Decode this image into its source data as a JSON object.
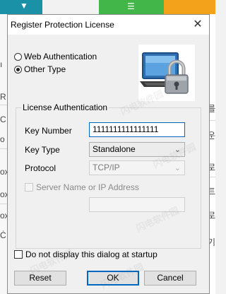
{
  "dialog": {
    "title": "Register Protection License",
    "close_glyph": "✕"
  },
  "auth_mode": {
    "options": [
      {
        "label": "Web Authentication",
        "checked": false
      },
      {
        "label": "Other Type",
        "checked": true
      }
    ]
  },
  "license_group": {
    "title": "License Authentication",
    "key_number_label": "Key Number",
    "key_number_value": "1111111111111111",
    "key_type_label": "Key Type",
    "key_type_value": "Standalone",
    "protocol_label": "Protocol",
    "protocol_value": "TCP/IP",
    "server_checkbox_label": "Server Name or IP Address",
    "server_value": ""
  },
  "startup_checkbox_label": "Do not display this dialog at startup",
  "buttons": {
    "reset": "Reset",
    "ok": "OK",
    "cancel": "Cancel"
  },
  "watermark": "闪电软件园",
  "background": {
    "left_fragments": [
      "ı",
      "R",
      "C",
      "o",
      "ox",
      "ox",
      "ox",
      "Ċ"
    ],
    "right_fragments": [
      "를",
      "운",
      "로",
      "트",
      "로",
      "기"
    ]
  },
  "colors": {
    "accent": "#0067c0",
    "tile_teal": "#1b91a8",
    "tile_green": "#42b649",
    "tile_orange": "#f2a21b"
  },
  "icons": {
    "logo": "laptop-padlock-icon"
  }
}
